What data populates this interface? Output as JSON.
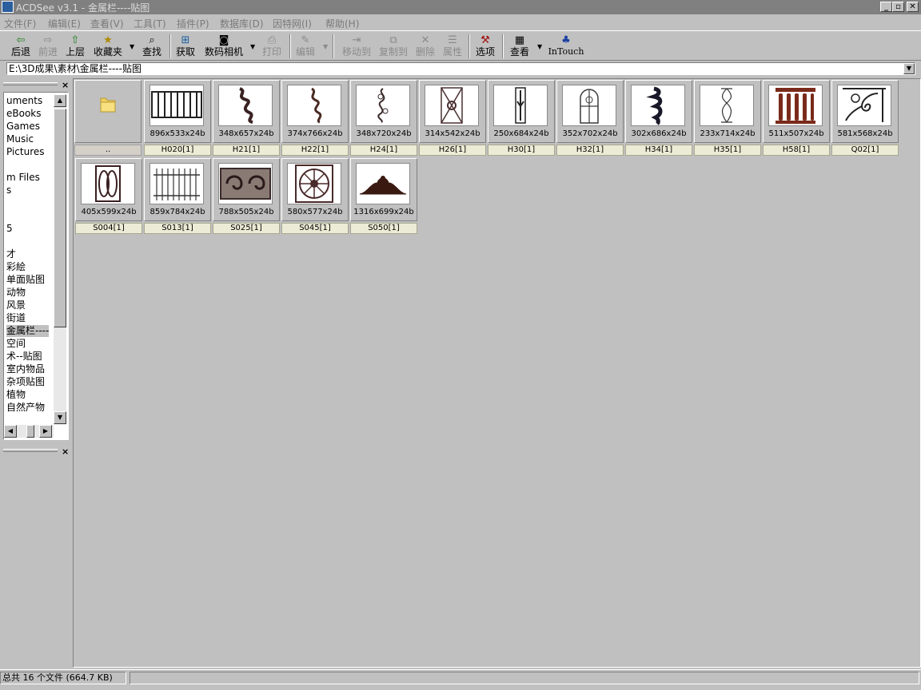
{
  "window": {
    "title": "ACDSee v3.1 - 金属栏----贴图",
    "minimize": "_",
    "restore": "▫",
    "close": "✕"
  },
  "menu": [
    "文件(F)",
    "编辑(E)",
    "查看(V)",
    "工具(T)",
    "插件(P)",
    "数据库(D)",
    "因特网(I)",
    "帮助(H)"
  ],
  "toolbar": [
    {
      "label": "后退",
      "icon": "back-arrow-icon",
      "glyph": "⇦",
      "enabled": true
    },
    {
      "label": "前进",
      "icon": "forward-arrow-icon",
      "glyph": "⇨",
      "enabled": false
    },
    {
      "label": "上层",
      "icon": "up-folder-icon",
      "glyph": "⇧",
      "enabled": true
    },
    {
      "label": "收藏夹",
      "icon": "favorites-icon",
      "glyph": "★",
      "enabled": true
    },
    {
      "label": "查找",
      "icon": "binoculars-icon",
      "glyph": "⌕",
      "enabled": true
    },
    {
      "label": "获取",
      "icon": "acquire-icon",
      "glyph": "⊞",
      "enabled": true
    },
    {
      "label": "数码相机",
      "icon": "camera-icon",
      "glyph": "◙",
      "enabled": true
    },
    {
      "label": "打印",
      "icon": "printer-icon",
      "glyph": "⎙",
      "enabled": false
    },
    {
      "label": "编辑",
      "icon": "edit-icon",
      "glyph": "✎",
      "enabled": false
    },
    {
      "label": "移动到",
      "icon": "move-to-icon",
      "glyph": "⇥",
      "enabled": false
    },
    {
      "label": "复制到",
      "icon": "copy-to-icon",
      "glyph": "⧉",
      "enabled": false
    },
    {
      "label": "删除",
      "icon": "delete-icon",
      "glyph": "✕",
      "enabled": false
    },
    {
      "label": "属性",
      "icon": "properties-icon",
      "glyph": "☰",
      "enabled": false
    },
    {
      "label": "选项",
      "icon": "options-icon",
      "glyph": "⚒",
      "enabled": true
    },
    {
      "label": "查看",
      "icon": "view-icon",
      "glyph": "▦",
      "enabled": true
    },
    {
      "label": "InTouch",
      "icon": "intouch-icon",
      "glyph": "♣",
      "enabled": true
    }
  ],
  "address": {
    "path": "E:\\3D成果\\素材\\金属栏----贴图"
  },
  "tree": {
    "items": [
      "uments",
      "eBooks",
      "Games",
      "Music",
      "Pictures",
      "",
      "m Files",
      "s",
      "",
      "",
      "5",
      "",
      "才",
      "彩絵",
      "单面贴图",
      "动物",
      "风景",
      "街道",
      "金属栏----",
      "空间",
      "术--贴图",
      "室内物品",
      "杂项贴图",
      "植物",
      "自然产物"
    ],
    "selected_index": 18
  },
  "thumbnails": [
    {
      "name": "..",
      "dims": "",
      "type": "folder"
    },
    {
      "name": "H020[1]",
      "dims": "896x533x24b"
    },
    {
      "name": "H21[1]",
      "dims": "348x657x24b"
    },
    {
      "name": "H22[1]",
      "dims": "374x766x24b"
    },
    {
      "name": "H24[1]",
      "dims": "348x720x24b"
    },
    {
      "name": "H26[1]",
      "dims": "314x542x24b"
    },
    {
      "name": "H30[1]",
      "dims": "250x684x24b"
    },
    {
      "name": "H32[1]",
      "dims": "352x702x24b"
    },
    {
      "name": "H34[1]",
      "dims": "302x686x24b"
    },
    {
      "name": "H35[1]",
      "dims": "233x714x24b"
    },
    {
      "name": "H58[1]",
      "dims": "511x507x24b"
    },
    {
      "name": "Q02[1]",
      "dims": "581x568x24b"
    },
    {
      "name": "S004[1]",
      "dims": "405x599x24b"
    },
    {
      "name": "S013[1]",
      "dims": "859x784x24b"
    },
    {
      "name": "S025[1]",
      "dims": "788x505x24b"
    },
    {
      "name": "S045[1]",
      "dims": "580x577x24b"
    },
    {
      "name": "S050[1]",
      "dims": "1316x699x24b"
    }
  ],
  "status": {
    "summary": "总共 16 个文件 (664.7 KB)"
  }
}
